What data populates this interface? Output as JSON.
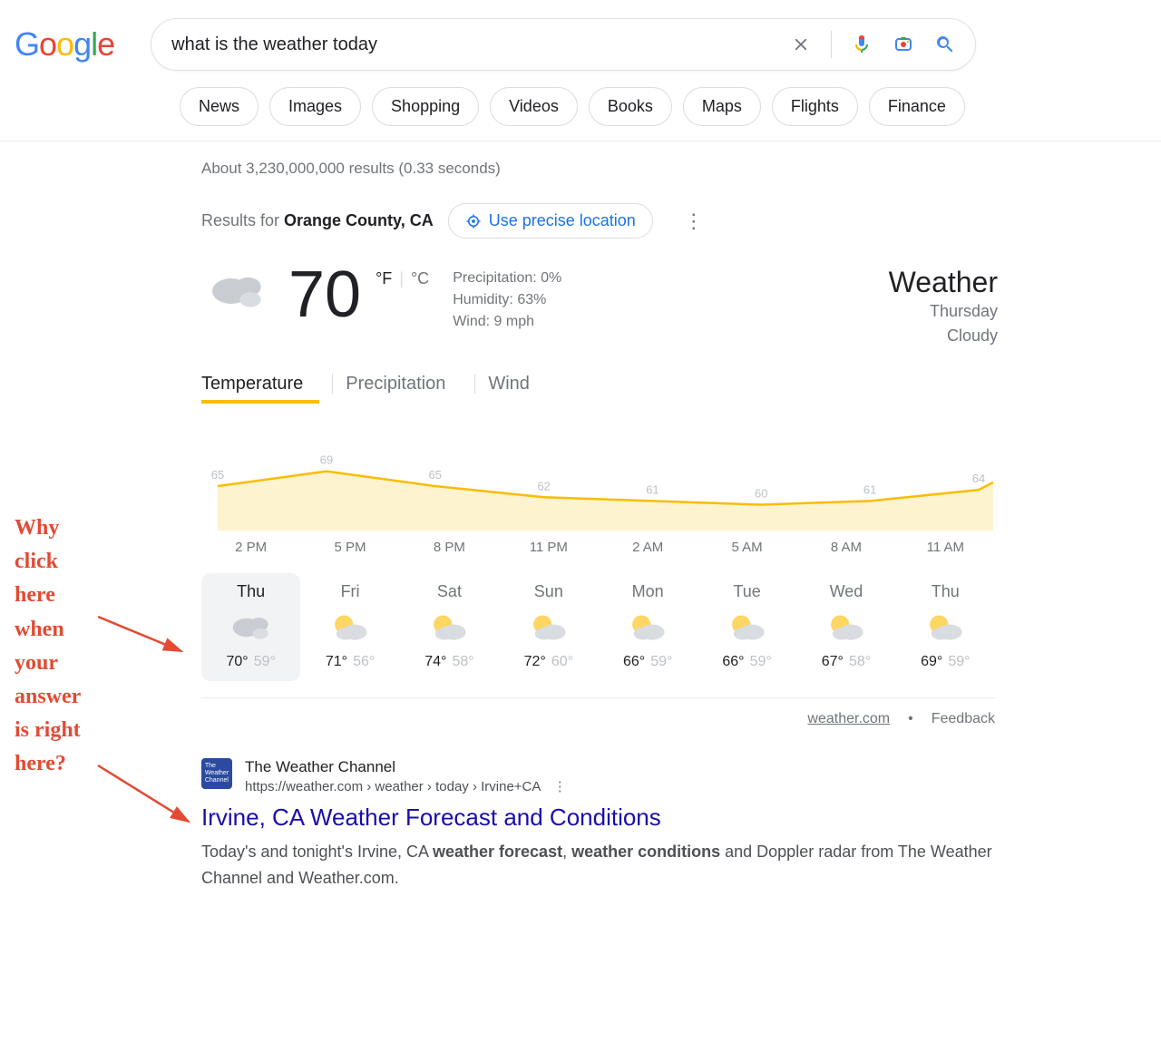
{
  "search": {
    "query": "what is the weather today"
  },
  "tabs": [
    "News",
    "Images",
    "Shopping",
    "Videos",
    "Books",
    "Maps",
    "Flights",
    "Finance"
  ],
  "stats": "About 3,230,000,000 results (0.33 seconds)",
  "location": {
    "prefix": "Results for ",
    "place": "Orange County, CA",
    "precise": "Use precise location"
  },
  "weather": {
    "temp": "70",
    "unit_f": "°F",
    "unit_c": "°C",
    "precip": "Precipitation: 0%",
    "humidity": "Humidity: 63%",
    "wind": "Wind: 9 mph",
    "title": "Weather",
    "day": "Thursday",
    "cond": "Cloudy",
    "wtabs": {
      "temp": "Temperature",
      "precip": "Precipitation",
      "wind": "Wind"
    }
  },
  "chart_data": {
    "type": "area",
    "title": "",
    "xlabel": "",
    "ylabel": "",
    "categories": [
      "2 PM",
      "5 PM",
      "8 PM",
      "11 PM",
      "2 AM",
      "5 AM",
      "8 AM",
      "11 AM"
    ],
    "values": [
      65,
      69,
      65,
      62,
      61,
      60,
      61,
      64
    ],
    "ylim": [
      55,
      75
    ]
  },
  "days": [
    {
      "name": "Thu",
      "hi": "70°",
      "lo": "59°",
      "icon": "cloudy",
      "selected": true
    },
    {
      "name": "Fri",
      "hi": "71°",
      "lo": "56°",
      "icon": "partly",
      "selected": false
    },
    {
      "name": "Sat",
      "hi": "74°",
      "lo": "58°",
      "icon": "partly",
      "selected": false
    },
    {
      "name": "Sun",
      "hi": "72°",
      "lo": "60°",
      "icon": "partly",
      "selected": false
    },
    {
      "name": "Mon",
      "hi": "66°",
      "lo": "59°",
      "icon": "partly",
      "selected": false
    },
    {
      "name": "Tue",
      "hi": "66°",
      "lo": "59°",
      "icon": "partly",
      "selected": false
    },
    {
      "name": "Wed",
      "hi": "67°",
      "lo": "58°",
      "icon": "partly",
      "selected": false
    },
    {
      "name": "Thu",
      "hi": "69°",
      "lo": "59°",
      "icon": "partly",
      "selected": false
    }
  ],
  "footer": {
    "source": "weather.com",
    "sep": "•",
    "feedback": "Feedback"
  },
  "result": {
    "source_name": "The Weather Channel",
    "url": "https://weather.com › weather › today › Irvine+CA",
    "title": "Irvine, CA Weather Forecast and Conditions",
    "desc_pre": "Today's and tonight's Irvine, CA ",
    "desc_b1": "weather forecast",
    "desc_mid1": ", ",
    "desc_b2": "weather conditions",
    "desc_post": " and Doppler radar from The Weather Channel and Weather.com."
  },
  "annotation": {
    "l1": "Why",
    "l2": "click",
    "l3": "here",
    "l4": "when",
    "l5": "your",
    "l6": "answer",
    "l7": "is right",
    "l8": "here?"
  }
}
